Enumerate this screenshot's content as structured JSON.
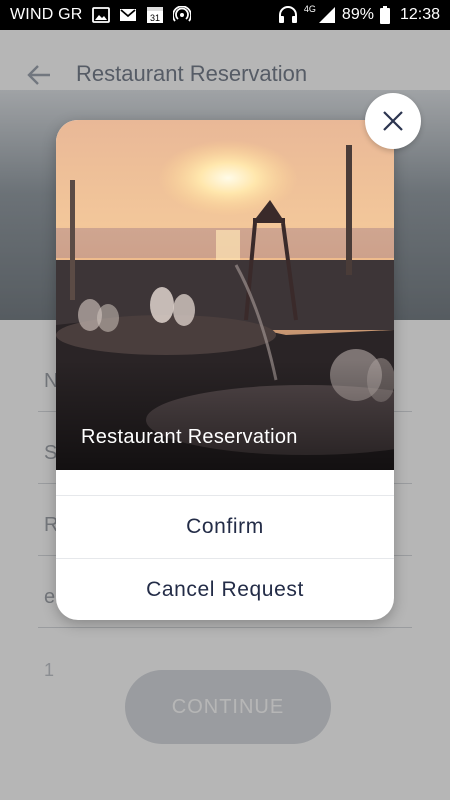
{
  "status_bar": {
    "carrier": "WIND GR",
    "icons": [
      "image-icon",
      "gmail-icon",
      "calendar-icon",
      "hotspot-icon"
    ],
    "calendar_day": "31",
    "right_icons": [
      "headphones-icon",
      "signal-icon",
      "battery-icon"
    ],
    "network": "4G",
    "battery": "89%",
    "time": "12:38"
  },
  "background_page": {
    "title": "Restaurant Reservation",
    "fields": [
      "N",
      "S",
      "R",
      "e"
    ],
    "counter": "1",
    "continue_label": "CONTINUE"
  },
  "modal": {
    "title": "Restaurant Reservation",
    "confirm_label": "Confirm",
    "cancel_label": "Cancel Request",
    "close_icon": "close-icon"
  },
  "colors": {
    "modal_button_text": "#232c47",
    "overlay": "rgba(80,80,80,0.42)",
    "continue_button": "#cfd3d9"
  }
}
